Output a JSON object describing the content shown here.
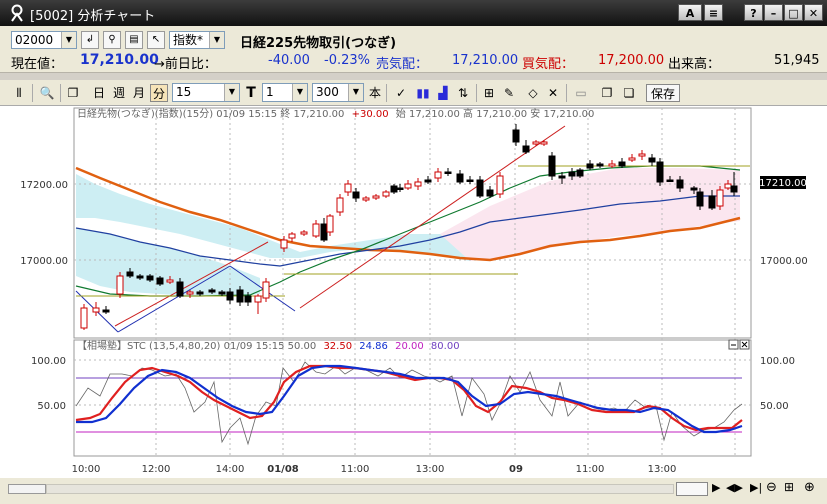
{
  "window": {
    "title": "[5002] 分析チャート"
  },
  "row1": {
    "code": "02000",
    "index_select": "指数*",
    "instrument": "日経225先物取引(つなぎ)"
  },
  "quote": {
    "current_label": "現在値：",
    "current_value": "17,210.00",
    "prev_label": "→前日比：",
    "change": "-40.00",
    "change_pct": "-0.23%",
    "ask_label": "売気配：",
    "ask_value": "17,210.00",
    "bid_label": "買気配：",
    "bid_value": "17,200.00",
    "volume_label": "出来高：",
    "volume_value": "51,945"
  },
  "toolbar": {
    "day": "日",
    "week": "週",
    "month": "月",
    "minute": "分",
    "interval": "15",
    "t_value": "1",
    "count": "300",
    "count_unit": "本",
    "save": "保存"
  },
  "chart": {
    "header": "日経先物(つなぎ)(指数)(15分) 01/09 15:15 終 17,210.00",
    "header_change": "+30.00",
    "header_rest": "始 17,210.00 高 17,210.00 安 17,210.00",
    "price_ticks": [
      "17200.00",
      "17000.00"
    ],
    "last_price_label": "17210.00",
    "osc_header": "【相場塾】STC (13,5,4,80,20) 01/09 15:15 50.00",
    "osc_v1": "32.50",
    "osc_v2": "24.86",
    "osc_v3": "20.00",
    "osc_v4": "80.00",
    "osc_ticks": [
      "100.00",
      "50.00"
    ],
    "time_ticks": [
      "10:00",
      "12:00",
      "14:00",
      "01/08",
      "11:00",
      "13:00",
      "09",
      "11:00",
      "13:00"
    ],
    "colors": {
      "up": "#cc0000",
      "down": "#000000",
      "upper_fill": "#cdeef3",
      "lower_fill": "#fbe6ef"
    }
  }
}
